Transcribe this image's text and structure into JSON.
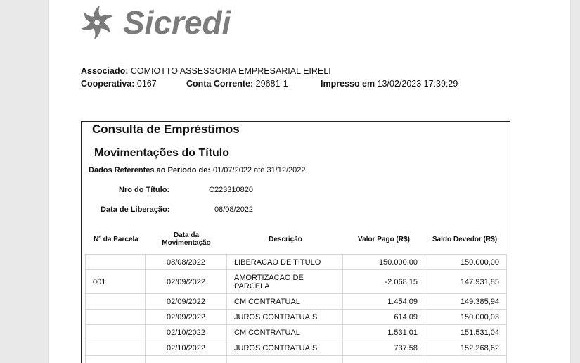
{
  "brand": {
    "name": "Sicredi",
    "logo_icon": "sicredi-pinwheel-icon",
    "logo_color": "#7b7b7b"
  },
  "header": {
    "associado_label": "Associado:",
    "associado_value": "COMIOTTO ASSESSORIA EMPRESARIAL EIRELI",
    "cooperativa_label": "Cooperativa:",
    "cooperativa_value": "0167",
    "conta_label": "Conta Corrente:",
    "conta_value": "29681-1",
    "impresso_label": "Impresso em",
    "impresso_value": "13/02/2023 17:39:29"
  },
  "report": {
    "title": "Consulta de Empréstimos",
    "subtitle": "Movimentações do Título",
    "periodo_label": "Dados Referentes ao Período de:",
    "periodo_value": "01/07/2022 até 31/12/2022",
    "titulo_label": "Nro do Título:",
    "titulo_value": "C223310820",
    "liberacao_label": "Data de Liberação:",
    "liberacao_value": "08/08/2022"
  },
  "table": {
    "headers": {
      "parcela": "Nº da Parcela",
      "data_line1": "Data da",
      "data_line2": "Movimentação",
      "descricao": "Descrição",
      "valor": "Valor Pago (R$)",
      "saldo": "Saldo Devedor (R$)"
    },
    "rows": [
      {
        "parcela": "",
        "data": "08/08/2022",
        "descricao": "LIBERACAO DE TITULO",
        "valor": "150.000,00",
        "saldo": "150.000,00"
      },
      {
        "parcela": "001",
        "data": "02/09/2022",
        "descricao": "AMORTIZACAO DE PARCELA",
        "valor": "-2.068,15",
        "saldo": "147.931,85"
      },
      {
        "parcela": "",
        "data": "02/09/2022",
        "descricao": "CM CONTRATUAL",
        "valor": "1.454,09",
        "saldo": "149.385,94"
      },
      {
        "parcela": "",
        "data": "02/09/2022",
        "descricao": "JUROS CONTRATUAIS",
        "valor": "614,09",
        "saldo": "150.000,03"
      },
      {
        "parcela": "",
        "data": "02/10/2022",
        "descricao": "CM CONTRATUAL",
        "valor": "1.531,01",
        "saldo": "151.531,04"
      },
      {
        "parcela": "",
        "data": "02/10/2022",
        "descricao": "JUROS CONTRATUAIS",
        "valor": "737,58",
        "saldo": "152.268,62"
      },
      {
        "parcela": "",
        "data": "",
        "descricao": "",
        "valor": "",
        "saldo": ""
      }
    ]
  }
}
